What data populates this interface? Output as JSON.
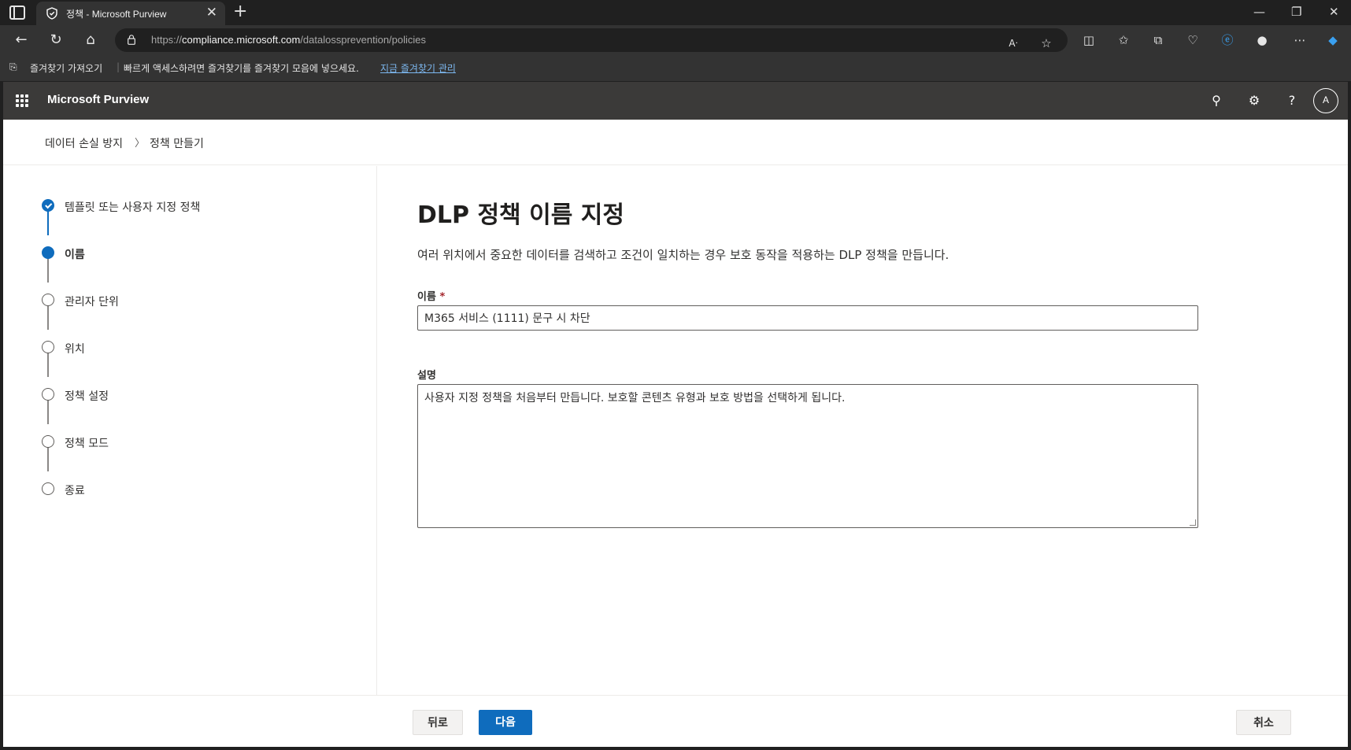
{
  "browser": {
    "tab_title": "정책 - Microsoft Purview",
    "url_prefix": "https://",
    "url_host": "compliance.microsoft.com",
    "url_path": "/datalossprevention/policies",
    "favorites_import": "즐겨찾기 가져오기",
    "favorites_prompt": "빠르게 액세스하려면 즐겨찾기를 즐겨찾기 모음에 넣으세요.",
    "favorites_manage_link": "지금 즐겨찾기 관리"
  },
  "app": {
    "name": "Microsoft Purview",
    "avatar_initial": "A"
  },
  "breadcrumb": {
    "items": [
      "데이터 손실 방지",
      "정책 만들기"
    ],
    "separator": "〉"
  },
  "steps": [
    {
      "label": "템플릿 또는 사용자 지정 정책",
      "state": "done"
    },
    {
      "label": "이름",
      "state": "current"
    },
    {
      "label": "관리자 단위",
      "state": "pending"
    },
    {
      "label": "위치",
      "state": "pending"
    },
    {
      "label": "정책 설정",
      "state": "pending"
    },
    {
      "label": "정책 모드",
      "state": "pending"
    },
    {
      "label": "종료",
      "state": "pending"
    }
  ],
  "form": {
    "heading": "DLP 정책 이름 지정",
    "description_text": "여러 위치에서 중요한 데이터를 검색하고 조건이 일치하는 경우 보호 동작을 적용하는 DLP 정책을 만듭니다.",
    "name_label": "이름",
    "required_marker": "*",
    "name_value": "M365 서비스 (1111) 문구 시 차단",
    "desc_label": "설명",
    "desc_value": "사용자 지정 정책을 처음부터 만듭니다. 보호할 콘텐츠 유형과 보호 방법을 선택하게 됩니다."
  },
  "footer": {
    "back_label": "뒤로",
    "next_label": "다음",
    "cancel_label": "취소"
  },
  "colors": {
    "accent": "#0f6cbd",
    "appbar": "#3b3a39"
  }
}
